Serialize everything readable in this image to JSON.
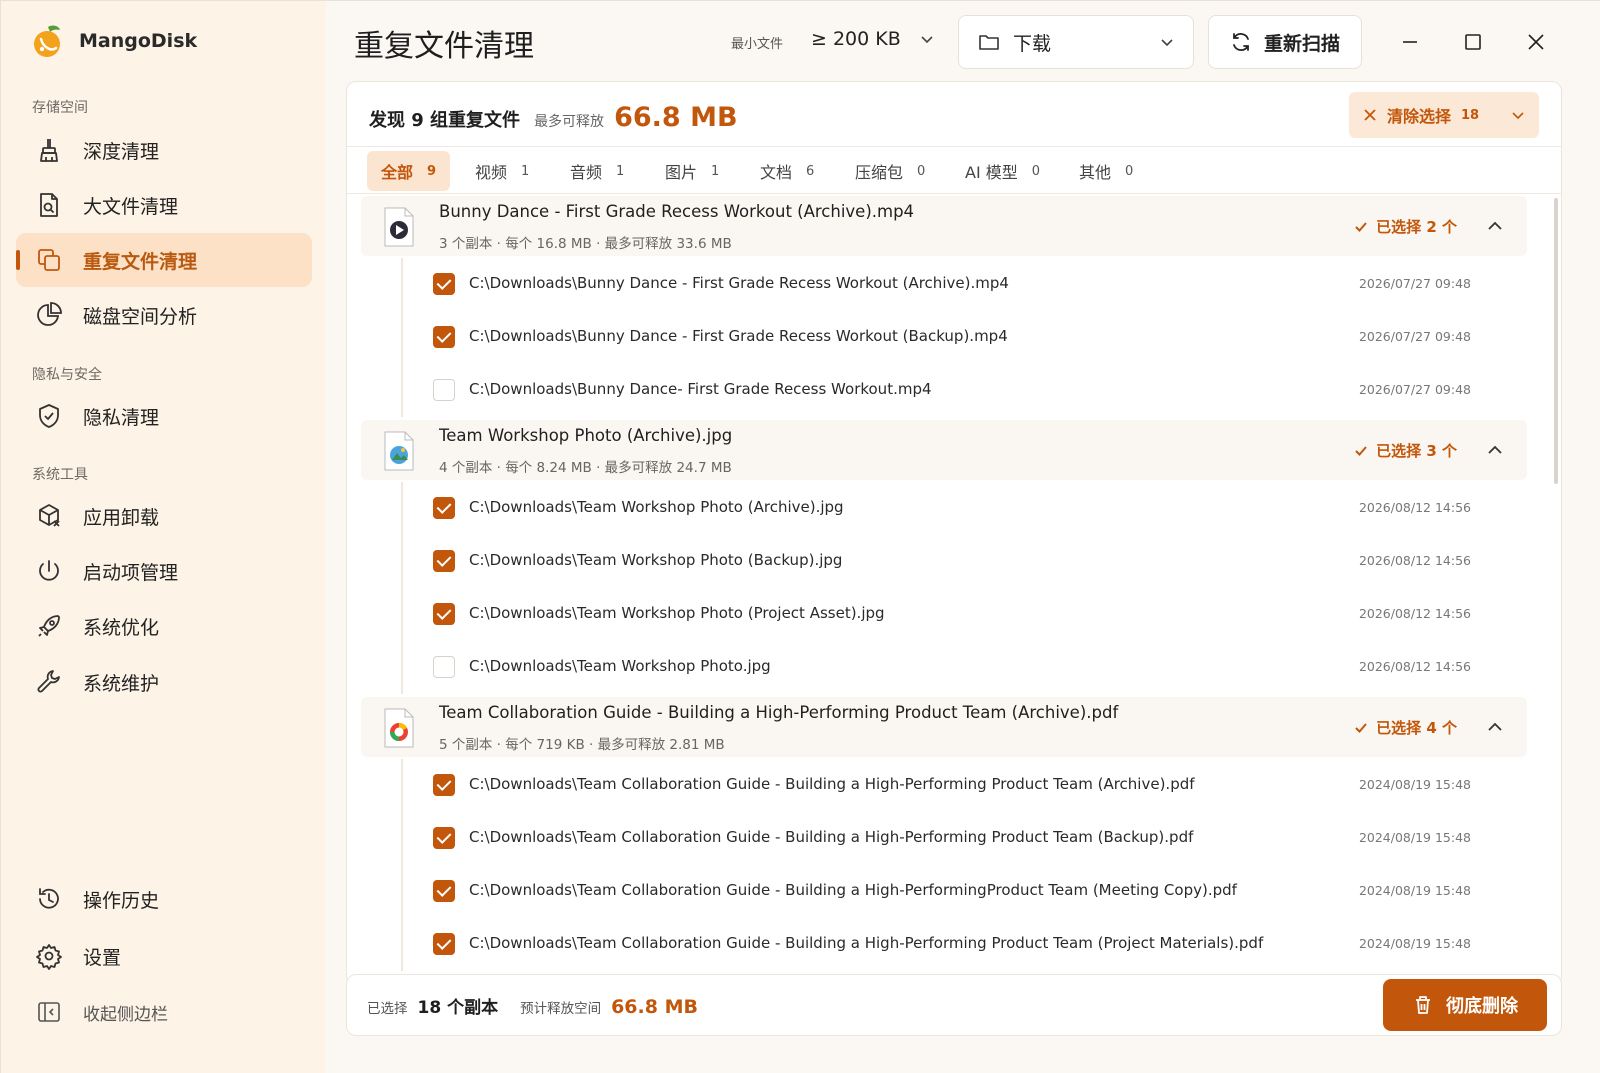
{
  "app": {
    "name": "MangoDisk"
  },
  "sidebar": {
    "sections": [
      {
        "label": "存储空间"
      },
      {
        "label": "隐私与安全"
      },
      {
        "label": "系统工具"
      }
    ],
    "items": [
      {
        "label": "深度清理",
        "icon": "broom-icon"
      },
      {
        "label": "大文件清理",
        "icon": "large-file-icon"
      },
      {
        "label": "重复文件清理",
        "icon": "duplicate-icon",
        "active": true
      },
      {
        "label": "磁盘空间分析",
        "icon": "pie-chart-icon"
      },
      {
        "label": "隐私清理",
        "icon": "shield-icon"
      },
      {
        "label": "应用卸载",
        "icon": "uninstall-box-icon"
      },
      {
        "label": "启动项管理",
        "icon": "power-icon"
      },
      {
        "label": "系统优化",
        "icon": "rocket-icon"
      },
      {
        "label": "系统维护",
        "icon": "wrench-icon"
      },
      {
        "label": "操作历史",
        "icon": "history-icon"
      },
      {
        "label": "设置",
        "icon": "gear-icon"
      }
    ],
    "collapse_label": "收起侧边栏"
  },
  "header": {
    "title": "重复文件清理",
    "min_file_label": "最小文件",
    "min_file_value": "≥ 200 KB",
    "folder": "下载",
    "rescan_label": "重新扫描"
  },
  "summary": {
    "found_text": "发现 9 组重复文件",
    "max_free_label": "最多可释放",
    "max_free_value": "66.8 MB",
    "clear_label": "清除选择",
    "clear_count": "18"
  },
  "tabs": [
    {
      "label": "全部",
      "count": "9",
      "active": true
    },
    {
      "label": "视频",
      "count": "1"
    },
    {
      "label": "音频",
      "count": "1"
    },
    {
      "label": "图片",
      "count": "1"
    },
    {
      "label": "文档",
      "count": "6"
    },
    {
      "label": "压缩包",
      "count": "0"
    },
    {
      "label": "AI 模型",
      "count": "0"
    },
    {
      "label": "其他",
      "count": "0"
    }
  ],
  "groups": [
    {
      "name": "Bunny Dance - First Grade Recess Workout (Archive).mp4",
      "meta": "3 个副本 · 每个 16.8 MB · 最多可释放 33.6 MB",
      "selected": "已选择 2 个",
      "icon": "video-file-icon",
      "files": [
        {
          "path": "C:\\Downloads\\Bunny Dance - First Grade Recess Workout (Archive).mp4",
          "date": "2026/07/27 09:48",
          "checked": true
        },
        {
          "path": "C:\\Downloads\\Bunny Dance - First Grade Recess Workout (Backup).mp4",
          "date": "2026/07/27 09:48",
          "checked": true
        },
        {
          "path": "C:\\Downloads\\Bunny Dance- First Grade Recess Workout.mp4",
          "date": "2026/07/27 09:48",
          "checked": false
        }
      ]
    },
    {
      "name": "Team Workshop Photo (Archive).jpg",
      "meta": "4 个副本 · 每个 8.24 MB · 最多可释放 24.7 MB",
      "selected": "已选择 3 个",
      "icon": "image-file-icon",
      "files": [
        {
          "path": "C:\\Downloads\\Team Workshop Photo (Archive).jpg",
          "date": "2026/08/12 14:56",
          "checked": true
        },
        {
          "path": "C:\\Downloads\\Team Workshop Photo (Backup).jpg",
          "date": "2026/08/12 14:56",
          "checked": true
        },
        {
          "path": "C:\\Downloads\\Team Workshop Photo (Project Asset).jpg",
          "date": "2026/08/12 14:56",
          "checked": true
        },
        {
          "path": "C:\\Downloads\\Team Workshop Photo.jpg",
          "date": "2026/08/12 14:56",
          "checked": false
        }
      ]
    },
    {
      "name": "Team Collaboration Guide - Building a High-Performing Product Team (Archive).pdf",
      "meta": "5 个副本 · 每个 719 KB · 最多可释放 2.81 MB",
      "selected": "已选择 4 个",
      "icon": "pdf-file-icon",
      "files": [
        {
          "path": "C:\\Downloads\\Team Collaboration Guide - Building a High-Performing Product Team (Archive).pdf",
          "date": "2024/08/19 15:48",
          "checked": true
        },
        {
          "path": "C:\\Downloads\\Team Collaboration Guide - Building a High-Performing Product Team (Backup).pdf",
          "date": "2024/08/19 15:48",
          "checked": true
        },
        {
          "path": "C:\\Downloads\\Team Collaboration Guide - Building a High-PerformingProduct Team (Meeting Copy).pdf",
          "date": "2024/08/19 15:48",
          "checked": true
        },
        {
          "path": "C:\\Downloads\\Team Collaboration Guide - Building a High-Performing Product Team (Project Materials).pdf",
          "date": "2024/08/19 15:48",
          "checked": true
        }
      ]
    }
  ],
  "footer": {
    "selected_label": "已选择",
    "selected_value": "18 个副本",
    "estimate_label": "预计释放空间",
    "estimate_value": "66.8 MB",
    "delete_label": "彻底删除"
  },
  "colors": {
    "accent": "#c2570c",
    "accent_soft": "#fce5d0",
    "sidebar_bg": "#fdf3e7"
  }
}
